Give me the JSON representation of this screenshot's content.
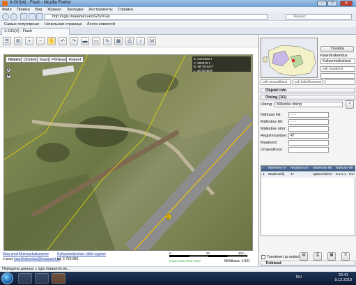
{
  "window": {
    "title": "X-GIS(4) - Flash - Mozilla Firefox"
  },
  "menu": [
    "Файл",
    "Правка",
    "Вид",
    "Журнал",
    "Закладки",
    "Инструменты",
    "Справка"
  ],
  "nav": {
    "url": "http://xgis.maaamet.ee/xGIS/XGis",
    "search_placeholder": "Яндекс"
  },
  "bookmarks": [
    "Самые популярные",
    "Начальная страница",
    "Лента новостей"
  ],
  "tab": {
    "label": "X-GIS(4) - Flash"
  },
  "map": {
    "tabs": [
      "Hübriid",
      "Ortofoto",
      "Kaart",
      "Põhikaart",
      "Reljeef"
    ],
    "active_tab": "Hübriid",
    "coords": {
      "x": "X: 6470120.7",
      "y": "Y: 500870.7",
      "b": "B: 58°20'44.0\"",
      "l": "L: 26°28'48.9\""
    },
    "footer": {
      "link1": "Maa-amet",
      "link2": "Muinsuskaitseamet",
      "link3": "Kultuurimälestiste riiklik register",
      "email_prefix": "e-post:",
      "email": "kaardirakendus@maaamet.ee",
      "phone": "tel: 6 750 865",
      "scale_mid": "20",
      "scale_end": "40m",
      "scale_label": "Mõõtkava: 1:551",
      "copyright": "Kaart: Maa-amet 2010"
    }
  },
  "right_panel": {
    "tuvasta_button": "Tuvasta",
    "kaardirakendus_label": "Kaardirakendus",
    "kaardirakendus_value": "Kultuurimälestised",
    "maakond_placeholder": "vali maakond",
    "omavalitsus_placeholder": "vali omavalitsus",
    "kyla_placeholder": "vali küla/linnaosa",
    "objekti_info_title": "Objekti info",
    "otsing_title": "Otsing (1/1)",
    "otsing_label": "Otsing:",
    "otsing_value": "Mälestise otsing",
    "fields": [
      {
        "label": "Nähtuse liik:",
        "value": "- - -"
      },
      {
        "label": "Mälestise liik:",
        "value": "- - -"
      },
      {
        "label": "Mälestise nimi:",
        "value": ""
      },
      {
        "label": "Registrinumber:",
        "value": "47"
      },
      {
        "label": "Maakond:",
        "value": ""
      },
      {
        "label": "Omavalitsus:",
        "value": ""
      }
    ],
    "table": {
      "headers": [
        "i",
        "Mälestise nr",
        "Registrinum",
        "Mälestise liik",
        "Nähtuse liik"
      ],
      "row": [
        "1",
        "Maalmasõj",
        "47",
        "ajaloomälest",
        "8.4.2.1 - Iinn"
      ]
    },
    "taseme_label": "Tsentreeri ja muhuta",
    "trykised_title": "Trükised"
  },
  "status": {
    "text": "Передача данных с xgis.maaamet.ee..."
  },
  "taskbar": {
    "lang": "RU",
    "time": "23:41",
    "date": "9.12.2010"
  },
  "colors": {
    "accent": "#3e5a82",
    "link": "#1a3fa8",
    "road": "#f2c200"
  }
}
